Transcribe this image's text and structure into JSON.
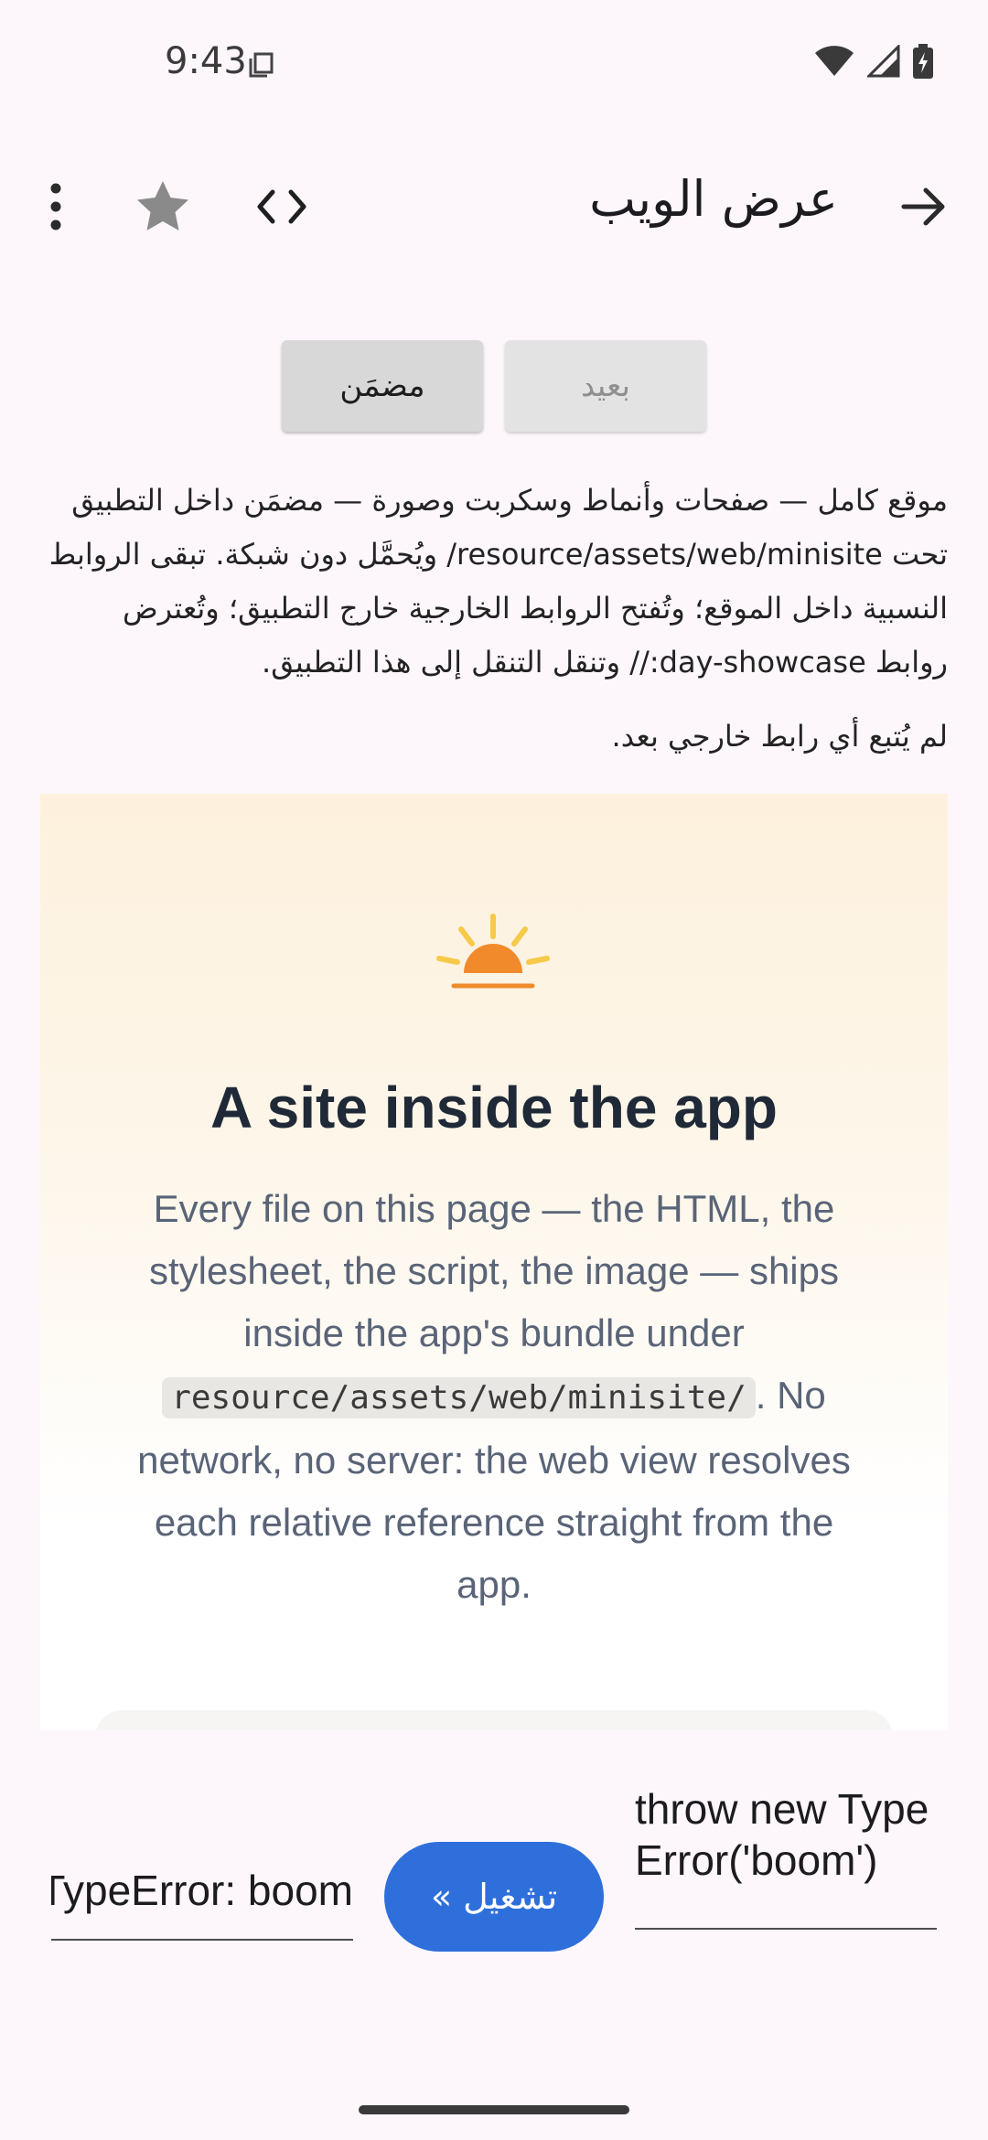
{
  "status_bar": {
    "time": "9:43"
  },
  "app_bar": {
    "title": "عرض الويب"
  },
  "mode_buttons": {
    "remote": "بعيد",
    "embedded": "مضمَن"
  },
  "description": "موقع كامل — صفحات وأنماط وسكربت وصورة — مضمَن داخل التطبيق تحت resource/assets/web/minisite/ ويُحمَّل دون شبكة. تبقى الروابط النسبية داخل الموقع؛ وتُفتح الروابط الخارجية خارج التطبيق؛ وتُعترض روابط day-showcase:// وتنقل التنقل إلى هذا التطبيق.",
  "followed_status": "لم يُتبع أي رابط خارجي بعد.",
  "webview": {
    "title": "A site inside the app",
    "text_before": "Every file on this page — the HTML, the stylesheet, the script, the image — ships inside the app's bundle under ",
    "code": "resource/assets/web/minisite/",
    "text_after": ". No network, no server: the web view resolves each relative reference straight from the app."
  },
  "bottom": {
    "output_value": "TypeError: boom",
    "run_label": "تشغيل »",
    "code_value": "throw new TypeError('boom')"
  },
  "colors": {
    "accent": "#2e6fdb",
    "background": "#fdf7fc",
    "sun_orange": "#f08a2b",
    "sun_yellow": "#f7c948"
  }
}
